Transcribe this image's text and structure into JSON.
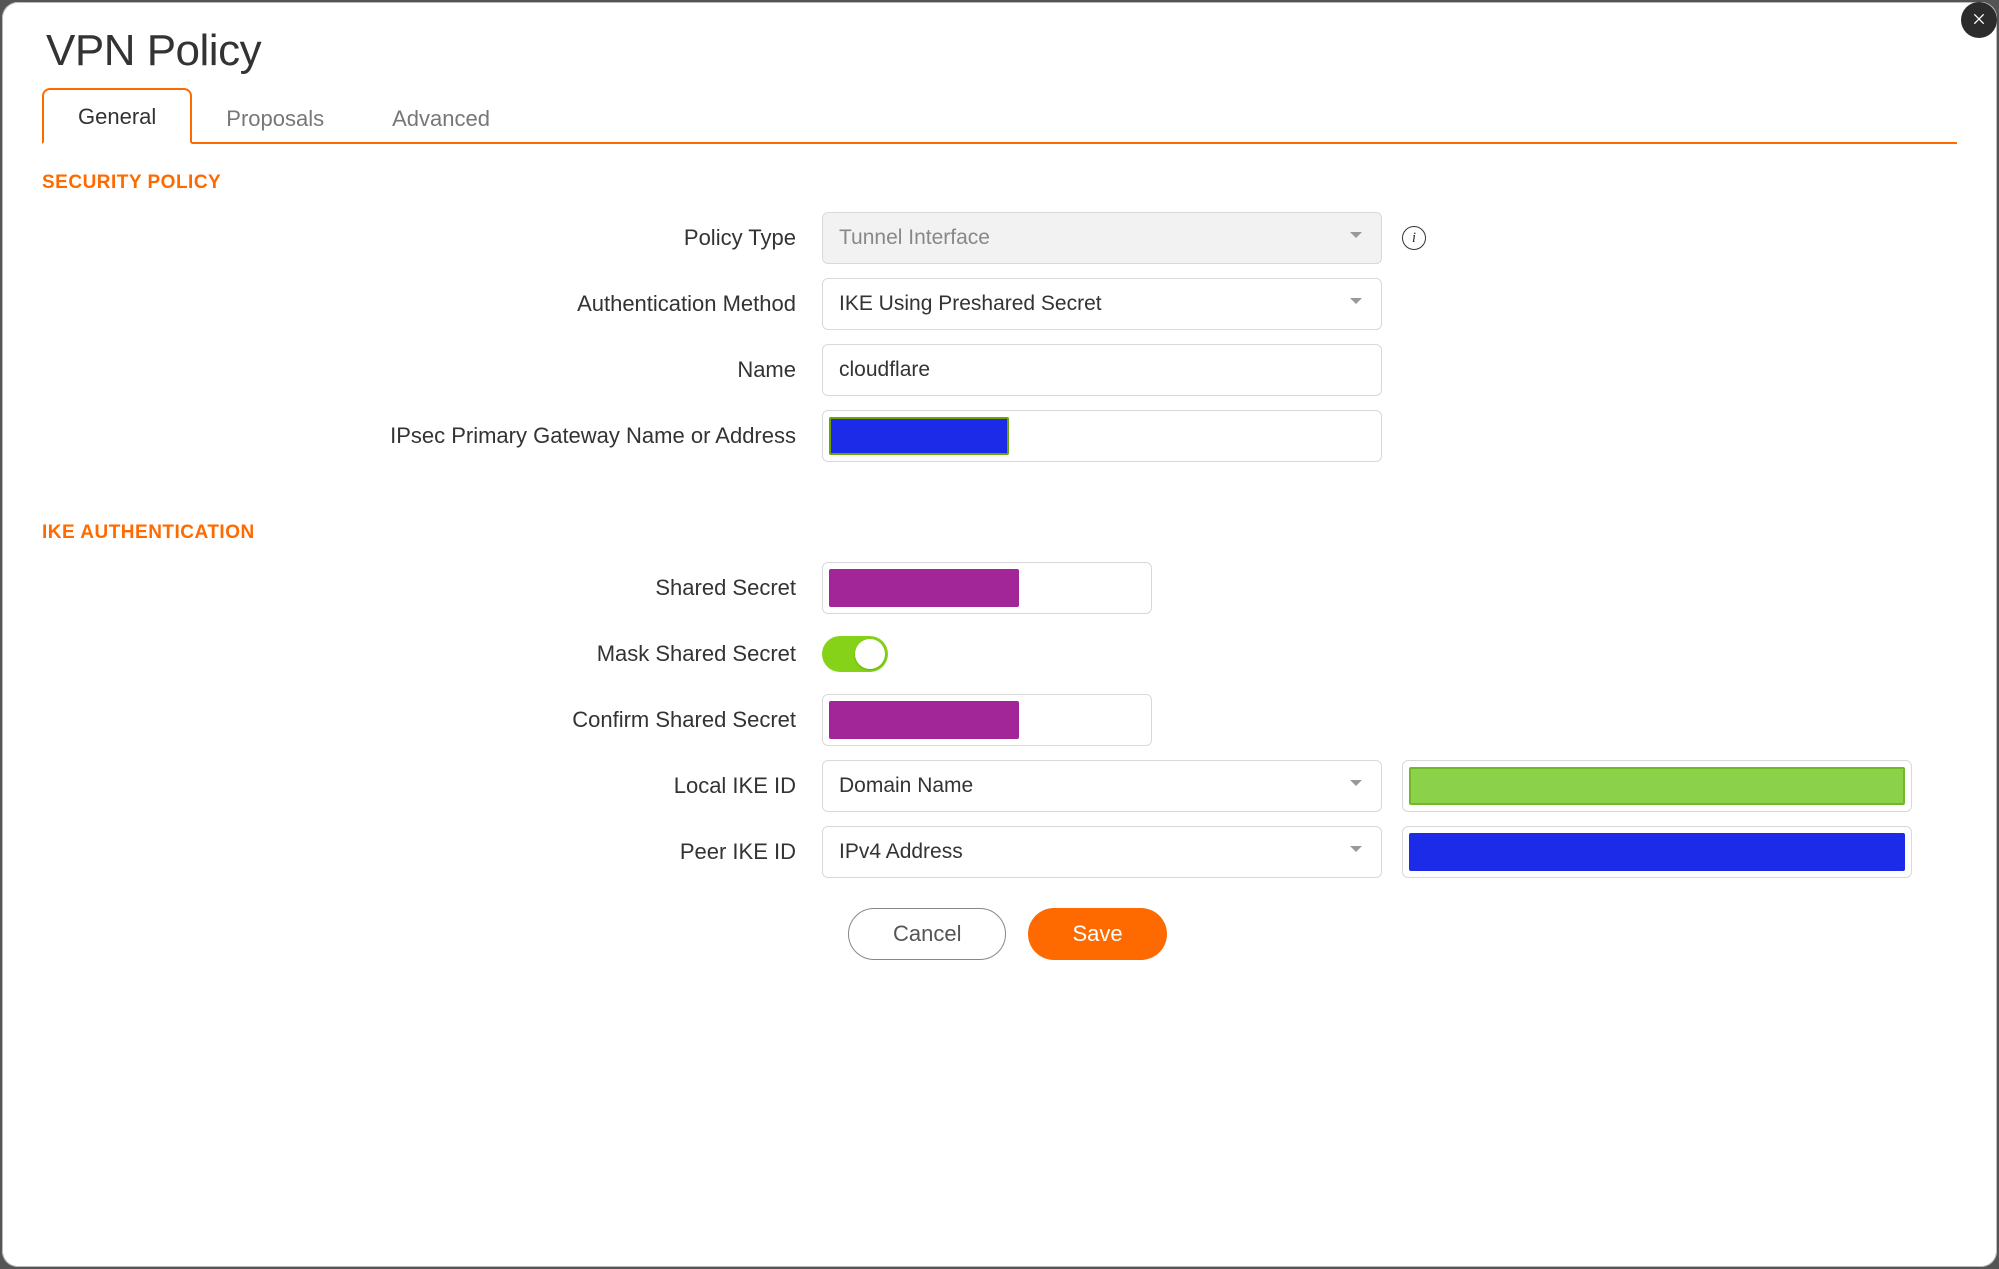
{
  "dialog": {
    "title": "VPN Policy",
    "tabs": [
      {
        "label": "General",
        "active": true
      },
      {
        "label": "Proposals",
        "active": false
      },
      {
        "label": "Advanced",
        "active": false
      }
    ]
  },
  "security_policy": {
    "heading": "SECURITY POLICY",
    "fields": {
      "policy_type": {
        "label": "Policy Type",
        "value": "Tunnel Interface",
        "disabled": true,
        "has_info": true
      },
      "auth_method": {
        "label": "Authentication Method",
        "value": "IKE Using Preshared Secret"
      },
      "name": {
        "label": "Name",
        "value": "cloudflare"
      },
      "ipsec_gateway": {
        "label": "IPsec Primary Gateway Name or Address",
        "value_redacted": true
      }
    }
  },
  "ike_auth": {
    "heading": "IKE AUTHENTICATION",
    "fields": {
      "shared_secret": {
        "label": "Shared Secret",
        "value_redacted": true
      },
      "mask_shared_secret": {
        "label": "Mask Shared Secret",
        "on": true
      },
      "confirm_shared_secret": {
        "label": "Confirm Shared Secret",
        "value_redacted": true
      },
      "local_ike_id": {
        "label": "Local IKE ID",
        "type_value": "Domain Name",
        "value_redacted": true
      },
      "peer_ike_id": {
        "label": "Peer IKE ID",
        "type_value": "IPv4 Address",
        "value_redacted": true
      }
    }
  },
  "buttons": {
    "cancel": "Cancel",
    "save": "Save"
  },
  "icons": {
    "close": "close-icon",
    "chevron_down": "chevron-down-icon",
    "info": "info-icon"
  }
}
